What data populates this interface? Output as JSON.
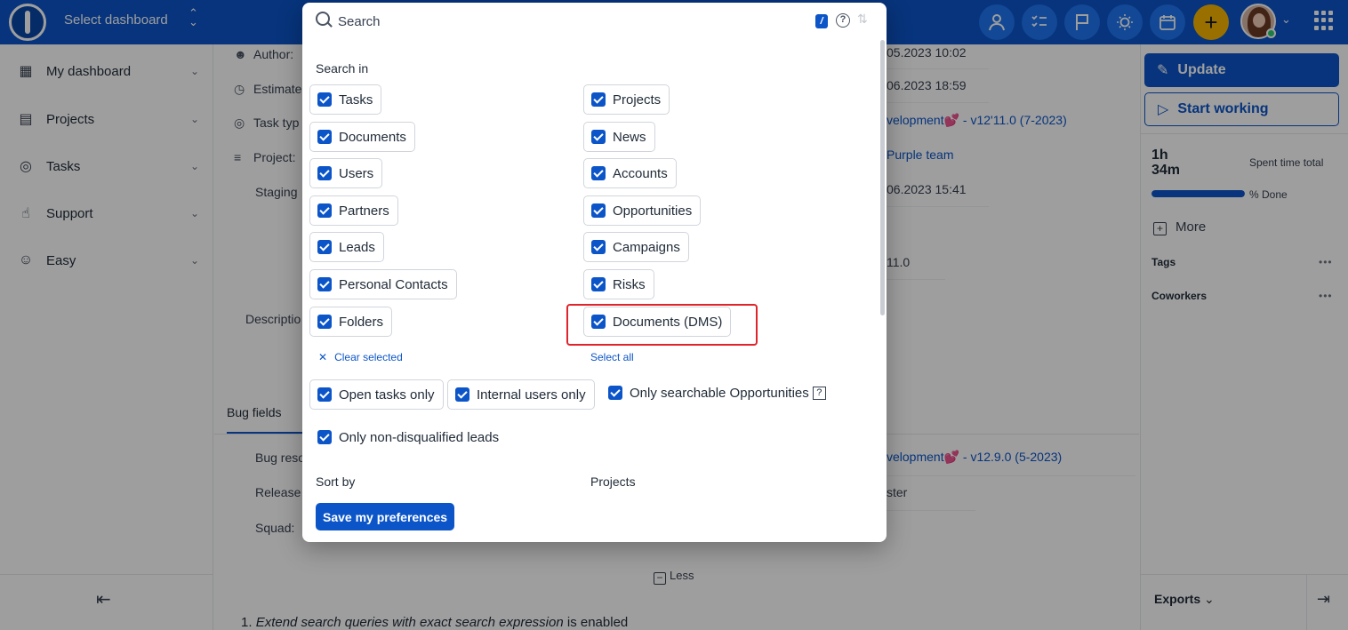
{
  "topbar": {
    "dashboard_select": "Select dashboard",
    "icons": [
      "user-icon",
      "checklist-icon",
      "flag-icon",
      "lightbulb-icon",
      "calendar-icon",
      "plus-icon"
    ],
    "brand_color": "#0c55c8",
    "plus_color": "#f7b500"
  },
  "sidebar": {
    "items": [
      {
        "label": "My dashboard",
        "icon": "dashboard-icon"
      },
      {
        "label": "Projects",
        "icon": "projects-icon"
      },
      {
        "label": "Tasks",
        "icon": "tasks-icon"
      },
      {
        "label": "Support",
        "icon": "support-icon"
      },
      {
        "label": "Easy",
        "icon": "easy-icon"
      }
    ]
  },
  "main": {
    "rows": {
      "author_label": "Author:",
      "estimate_label": "Estimate",
      "task_type_label": "Task typ",
      "project_label": "Project:",
      "staging_label": "Staging",
      "description_label": "Descriptio",
      "bug_res_label": "Bug reso",
      "release_label": "Release",
      "squad_label": "Squad:"
    },
    "values": {
      "author_date": "05.2023 10:02",
      "estimate_date": "06.2023 18:59",
      "task_type_value": "velopment💕 - v12'11.0 (7-2023)",
      "project_value": "Purple team",
      "staging_date": "06.2023 15:41",
      "version_value": "11.0",
      "bug_res_value": "velopment💕 - v12.9.0 (5-2023)",
      "release_value": "ster"
    },
    "tab_bugfields": "Bug fields",
    "less_label": "Less",
    "footnote_num": "1.",
    "footnote_em": "Extend search queries with exact search expression",
    "footnote_rest": " is enabled"
  },
  "right_panel": {
    "update_label": "Update",
    "start_label": "Start working",
    "spent_value": "1h 34m",
    "spent_label": "Spent time total",
    "done_pct": 100,
    "done_label": "% Done",
    "more_label": "More",
    "tags_label": "Tags",
    "coworkers_label": "Coworkers",
    "dots": "•••",
    "exports_label": "Exports"
  },
  "modal": {
    "search_placeholder": "Search",
    "kbd_hint": "/",
    "search_in_label": "Search in",
    "left_options": [
      "Tasks",
      "Documents",
      "Users",
      "Partners",
      "Leads",
      "Personal Contacts",
      "Folders"
    ],
    "right_options": [
      "Projects",
      "News",
      "Accounts",
      "Opportunities",
      "Campaigns",
      "Risks",
      "Documents (DMS)"
    ],
    "clear_selected": "Clear selected",
    "select_all": "Select all",
    "filters": {
      "open_tasks": "Open tasks only",
      "internal_users": "Internal users only",
      "searchable_opps": "Only searchable Opportunities",
      "non_disqualified": "Only non-disqualified leads"
    },
    "sort_by_label": "Sort by",
    "projects_label": "Projects",
    "save_label": "Save my preferences",
    "highlight_color": "#e0242b"
  }
}
